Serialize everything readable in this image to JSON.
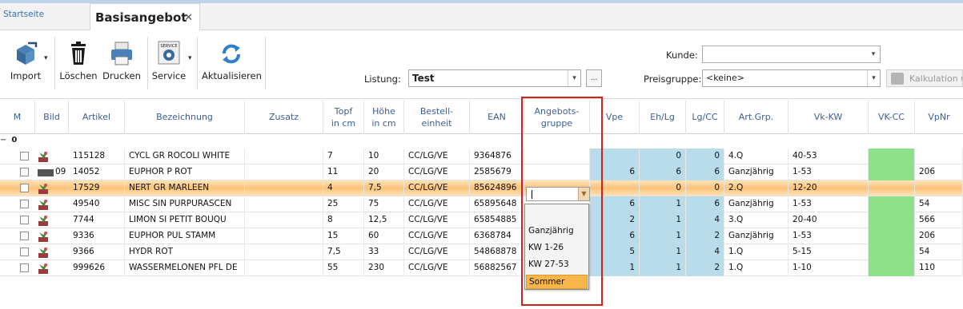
{
  "tabs": {
    "home": "Startseite",
    "active": "Basisangebot",
    "close": "✕"
  },
  "toolbar": {
    "import": "Import",
    "delete": "Löschen",
    "print": "Drucken",
    "service": "Service",
    "service_icon_text": "SERVICE",
    "refresh": "Aktualisieren"
  },
  "fields": {
    "listung_label": "Listung:",
    "listung_value": "Test",
    "kunde_label": "Kunde:",
    "kunde_value": "",
    "preisgruppe_label": "Preisgruppe:",
    "preisgruppe_value": "<keine>",
    "kalkulation": "Kalkulation üb",
    "ellipsis": "..."
  },
  "columns": {
    "m": "M",
    "bild": "Bild",
    "artikel": "Artikel",
    "bezeichnung": "Bezeichnung",
    "zusatz": "Zusatz",
    "topf1": "Topf",
    "topf2": "in cm",
    "hoehe1": "Höhe",
    "hoehe2": "in cm",
    "bestell1": "Bestell-",
    "bestell2": "einheit",
    "ean": "EAN",
    "angebot1": "Angebots-",
    "angebot2": "gruppe",
    "vpe": "Vpe",
    "ehlg": "Eh/Lg",
    "lgcc": "Lg/CC",
    "artgrp": "Art.Grp.",
    "vkkw": "Vk-KW",
    "vkcc": "VK-CC",
    "vpnr": "VpNr"
  },
  "group": {
    "toggle": "−",
    "label": "0"
  },
  "rows": [
    {
      "nr": "",
      "artikel": "115128",
      "bez": "CYCL GR ROCOLI WHITE",
      "topf": "7",
      "hoehe": "10",
      "be": "CC/LG/VE",
      "ean": "9364876",
      "ag": "",
      "vpe": "",
      "ehlg": "0",
      "lgcc": "0",
      "artgrp": "4.Q",
      "vkkw": "40-53",
      "vpnr": ""
    },
    {
      "nr": "09",
      "artikel": "14052",
      "bez": "EUPHOR P ROT",
      "topf": "11",
      "hoehe": "20",
      "be": "CC/LG/VE",
      "ean": "2585679",
      "ag": "",
      "vpe": "6",
      "ehlg": "6",
      "lgcc": "6",
      "artgrp": "Ganzjährig",
      "vkkw": "1-53",
      "vpnr": "206"
    },
    {
      "nr": "",
      "artikel": "17529",
      "bez": "NERT GR MARLEEN",
      "topf": "4",
      "hoehe": "7,5",
      "be": "CC/LG/VE",
      "ean": "85624896",
      "ag": "",
      "vpe": "",
      "ehlg": "0",
      "lgcc": "0",
      "artgrp": "2.Q",
      "vkkw": "12-20",
      "vpnr": ""
    },
    {
      "nr": "",
      "artikel": "49540",
      "bez": "MISC SIN PURPURASCEN",
      "topf": "25",
      "hoehe": "75",
      "be": "CC/LG/VE",
      "ean": "65895648",
      "ag": "",
      "vpe": "6",
      "ehlg": "1",
      "lgcc": "6",
      "artgrp": "Ganzjährig",
      "vkkw": "1-53",
      "vpnr": "54"
    },
    {
      "nr": "",
      "artikel": "7744",
      "bez": "LIMON SI PETIT BOUQU",
      "topf": "8",
      "hoehe": "12,5",
      "be": "CC/LG/VE",
      "ean": "65854885",
      "ag": "",
      "vpe": "2",
      "ehlg": "1",
      "lgcc": "4",
      "artgrp": "3.Q",
      "vkkw": "20-40",
      "vpnr": "566"
    },
    {
      "nr": "",
      "artikel": "9336",
      "bez": "EUPHOR PUL STAMM",
      "topf": "15",
      "hoehe": "60",
      "be": "CC/LG/VE",
      "ean": "6368784",
      "ag": "",
      "vpe": "6",
      "ehlg": "1",
      "lgcc": "2",
      "artgrp": "Ganzjährig",
      "vkkw": "1-53",
      "vpnr": "206"
    },
    {
      "nr": "",
      "artikel": "9366",
      "bez": "HYDR ROT",
      "topf": "7,5",
      "hoehe": "33",
      "be": "CC/LG/VE",
      "ean": "54868878",
      "ag": "",
      "vpe": "5",
      "ehlg": "1",
      "lgcc": "4",
      "artgrp": "1.Q",
      "vkkw": "5-15",
      "vpnr": "54"
    },
    {
      "nr": "",
      "artikel": "999626",
      "bez": "WASSERMELONEN PFL DE",
      "topf": "55",
      "hoehe": "230",
      "be": "CC/LG/VE",
      "ean": "56882567",
      "ag": "",
      "vpe": "1",
      "ehlg": "1",
      "lgcc": "2",
      "artgrp": "1.Q",
      "vkkw": "1-10",
      "vpnr": "110"
    }
  ],
  "dropdown": {
    "options": [
      "",
      "Ganzjährig",
      "KW 1-26",
      "KW 27-53",
      "Sommer"
    ],
    "highlighted": "Sommer"
  },
  "colors": {
    "accent": "#2f6fb3",
    "selected_row": "#fcc37b",
    "blue_cell": "#b9dceb",
    "green_cell": "#8fe08a",
    "highlight_box": "#d61f1f"
  }
}
